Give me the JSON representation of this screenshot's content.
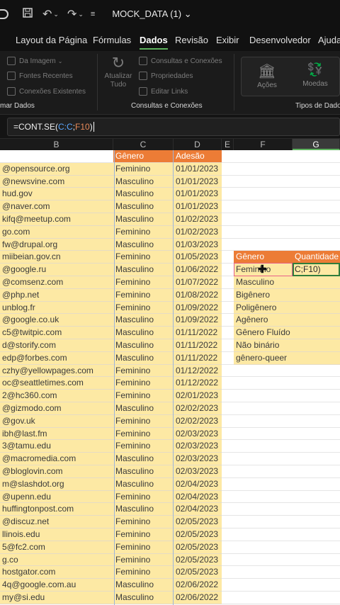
{
  "titlebar": {
    "title": "MOCK_DATA (1)",
    "title_arrow": "⌄",
    "icons": [
      "autosave-toggle-icon",
      "save-icon",
      "undo-icon",
      "redo-icon",
      "customize-quick-access-icon"
    ]
  },
  "menu": {
    "tabs": [
      "Layout da Página",
      "Fórmulas",
      "Dados",
      "Revisão",
      "Exibir",
      "Desenvolvedor",
      "Ajuda"
    ],
    "active": "Dados"
  },
  "ribbon": {
    "get_data": [
      "Da Imagem",
      "Fontes Recentes",
      "Conexões Existentes"
    ],
    "get_data_group": "mar Dados",
    "refresh_all": "Atualizar Tudo",
    "queries": [
      "Consultas e Conexões",
      "Propriedades",
      "Editar Links"
    ],
    "queries_group": "Consultas e Conexões",
    "data_types": [
      "Ações",
      "Moedas"
    ],
    "data_types_group": "Tipos de Dados"
  },
  "formula_bar": {
    "prefix": "=CONT.SE(",
    "range": "C:C",
    "sep": ";",
    "criteria": "F10",
    "suffix": ")"
  },
  "columns": [
    "B",
    "C",
    "D",
    "E",
    "F",
    "G"
  ],
  "grid": {
    "headers": {
      "C": "Gênero",
      "D": "Adesão"
    },
    "emails": [
      "@opensource.org",
      "@newsvine.com",
      "hud.gov",
      "@naver.com",
      "kifq@meetup.com",
      "go.com",
      "fw@drupal.org",
      "miibeian.gov.cn",
      "@google.ru",
      "@comsenz.com",
      "@php.net",
      "unblog.fr",
      "@google.co.uk",
      "c5@twitpic.com",
      "d@storify.com",
      "edp@forbes.com",
      "czhy@yellowpages.com",
      "oc@seattletimes.com",
      "2@hc360.com",
      "@gizmodo.com",
      "@gov.uk",
      "ibh@last.fm",
      "3@tamu.edu",
      "@macromedia.com",
      "@bloglovin.com",
      "m@slashdot.org",
      "@upenn.edu",
      "huffingtonpost.com",
      "@discuz.net",
      "llinois.edu",
      "5@fc2.com",
      "g.co",
      "hostgator.com",
      "4q@google.com.au",
      "my@si.edu"
    ],
    "genders": [
      "Feminino",
      "Masculino",
      "Masculino",
      "Masculino",
      "Masculino",
      "Feminino",
      "Masculino",
      "Feminino",
      "Masculino",
      "Feminino",
      "Feminino",
      "Feminino",
      "Masculino",
      "Masculino",
      "Masculino",
      "Masculino",
      "Feminino",
      "Feminino",
      "Feminino",
      "Masculino",
      "Feminino",
      "Feminino",
      "Feminino",
      "Masculino",
      "Masculino",
      "Masculino",
      "Feminino",
      "Masculino",
      "Feminino",
      "Feminino",
      "Feminino",
      "Feminino",
      "Feminino",
      "Masculino",
      "Masculino"
    ],
    "dates": [
      "01/01/2023",
      "01/01/2023",
      "01/01/2023",
      "01/01/2023",
      "01/02/2023",
      "01/02/2023",
      "01/03/2023",
      "01/05/2023",
      "01/06/2022",
      "01/07/2022",
      "01/08/2022",
      "01/09/2022",
      "01/09/2022",
      "01/11/2022",
      "01/11/2022",
      "01/11/2022",
      "01/12/2022",
      "01/12/2022",
      "02/01/2023",
      "02/02/2023",
      "02/02/2023",
      "02/03/2023",
      "02/03/2023",
      "02/03/2023",
      "02/03/2023",
      "02/04/2023",
      "02/04/2023",
      "02/04/2023",
      "02/05/2023",
      "02/05/2023",
      "02/05/2023",
      "02/05/2023",
      "02/05/2023",
      "02/06/2022",
      "02/06/2022"
    ]
  },
  "summary": {
    "header_gender": "Gênero",
    "header_qty": "Quantidade",
    "genders": [
      "Feminino",
      "Masculino",
      "Bigênero",
      "Poligênero",
      "Agênero",
      "Gênero Fluído",
      "Não binário",
      "gênero-queer"
    ],
    "g10_editing": "C;F10)"
  },
  "colors": {
    "header_orange": "#ec7c36",
    "cell_yellow": "#fde9a4",
    "selection_green": "#2f7d3c",
    "reference_pink": "#e7608a"
  }
}
